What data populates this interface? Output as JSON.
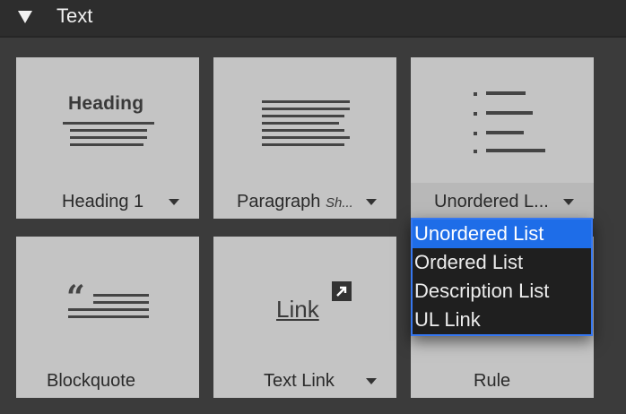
{
  "section": {
    "title": "Text"
  },
  "tiles": [
    {
      "label": "Heading 1",
      "icon_text": "Heading"
    },
    {
      "label": "Paragraph",
      "label_hint": "Sh..."
    },
    {
      "label": "Unordered L..."
    },
    {
      "label": "Blockquote"
    },
    {
      "label": "Text Link",
      "icon_text": "Link"
    },
    {
      "label": "Rule"
    }
  ],
  "dropdown": {
    "options": [
      "Unordered List",
      "Ordered List",
      "Description List",
      "UL Link"
    ],
    "selected": "Unordered List"
  },
  "colors": {
    "accent": "#1e6de8",
    "tile": "#c4c4c4",
    "panel": "#3b3b3b"
  }
}
